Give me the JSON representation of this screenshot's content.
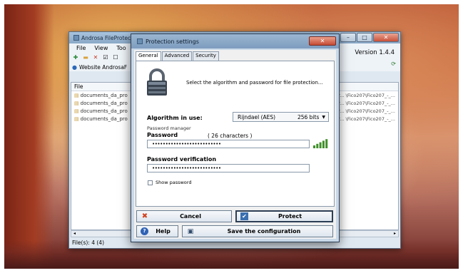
{
  "main_window": {
    "title": "Androsa FileProtector",
    "menu": [
      "File",
      "View",
      "Too"
    ],
    "version": "Version 1.4.4",
    "website_label": "Website AndrosaF",
    "file_column_header": "File",
    "files": [
      {
        "name": "documents_da_pro",
        "path": "Progr... \\Fico207\\Fico207_-_..."
      },
      {
        "name": "documents_da_pro",
        "path": "Progr... \\Fico207\\Fico207_-_..."
      },
      {
        "name": "documents_da_pro",
        "path": "Progr... \\Fico207\\Fico207_-_..."
      },
      {
        "name": "documents_da_pro",
        "path": "Progr... \\Fico207\\Fico207_-_..."
      }
    ],
    "status": "File(s): 4 (4)"
  },
  "dialog": {
    "title": "Protection settings",
    "tabs": [
      "General",
      "Advanced",
      "Security"
    ],
    "active_tab": "General",
    "instruction": "Select the algorithm and password for file protection...",
    "algorithm_label": "Algorithm in use:",
    "algorithm_name": "Rijndael (AES)",
    "algorithm_bits": "256 bits",
    "password_manager_label": "Password manager",
    "password_label": "Password",
    "password_count": "( 26 characters )",
    "password_value": "••••••••••••••••••••••••••",
    "password_verification_label": "Password verification",
    "password_verification_value": "••••••••••••••••••••••••••",
    "show_password_label": "Show password",
    "show_password_checked": false,
    "password_strength_bars": 5,
    "buttons": {
      "cancel": "Cancel",
      "protect": "Protect",
      "help": "Help",
      "save": "Save the configuration"
    }
  },
  "colors": {
    "accent": "#3a6fb0",
    "strength_bar": "#3f8f2a",
    "cancel_icon": "#d2421e"
  }
}
